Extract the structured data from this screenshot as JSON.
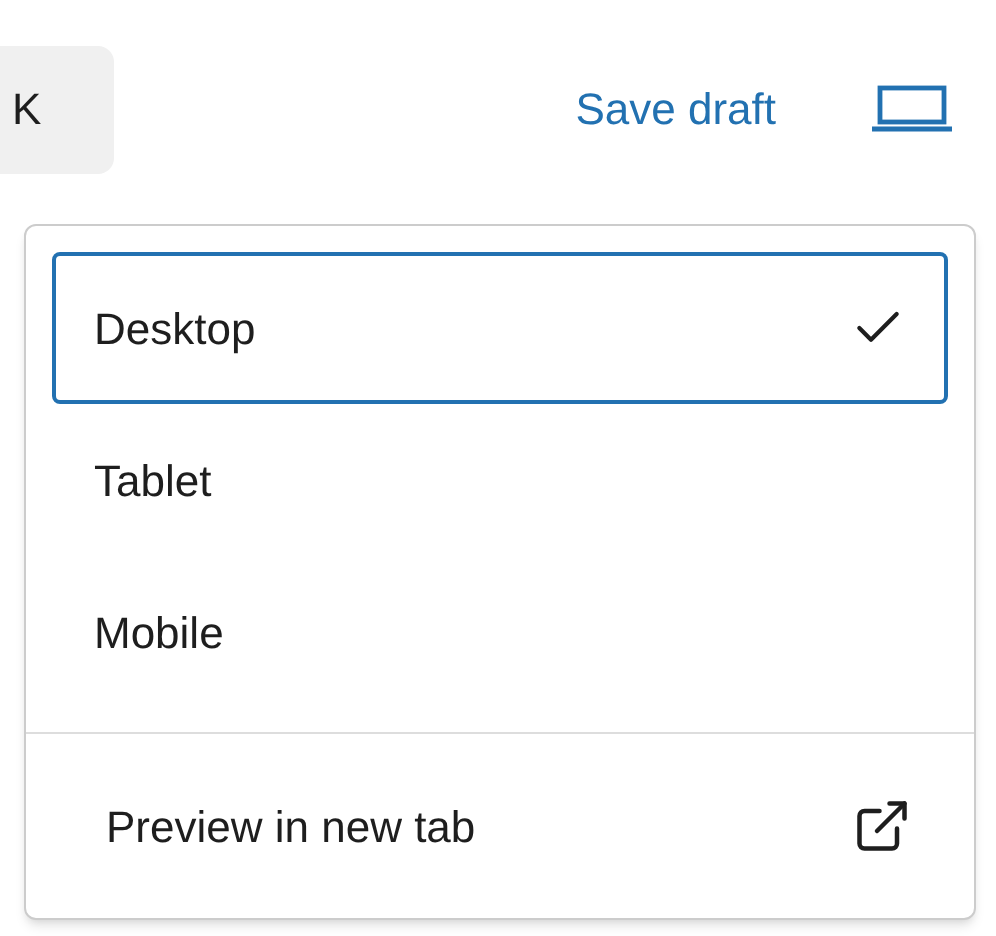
{
  "toolbar": {
    "command_button": "K",
    "save_draft": "Save draft"
  },
  "preview_menu": {
    "devices": [
      {
        "label": "Desktop",
        "selected": true
      },
      {
        "label": "Tablet",
        "selected": false
      },
      {
        "label": "Mobile",
        "selected": false
      }
    ],
    "preview_link": "Preview in new tab"
  }
}
